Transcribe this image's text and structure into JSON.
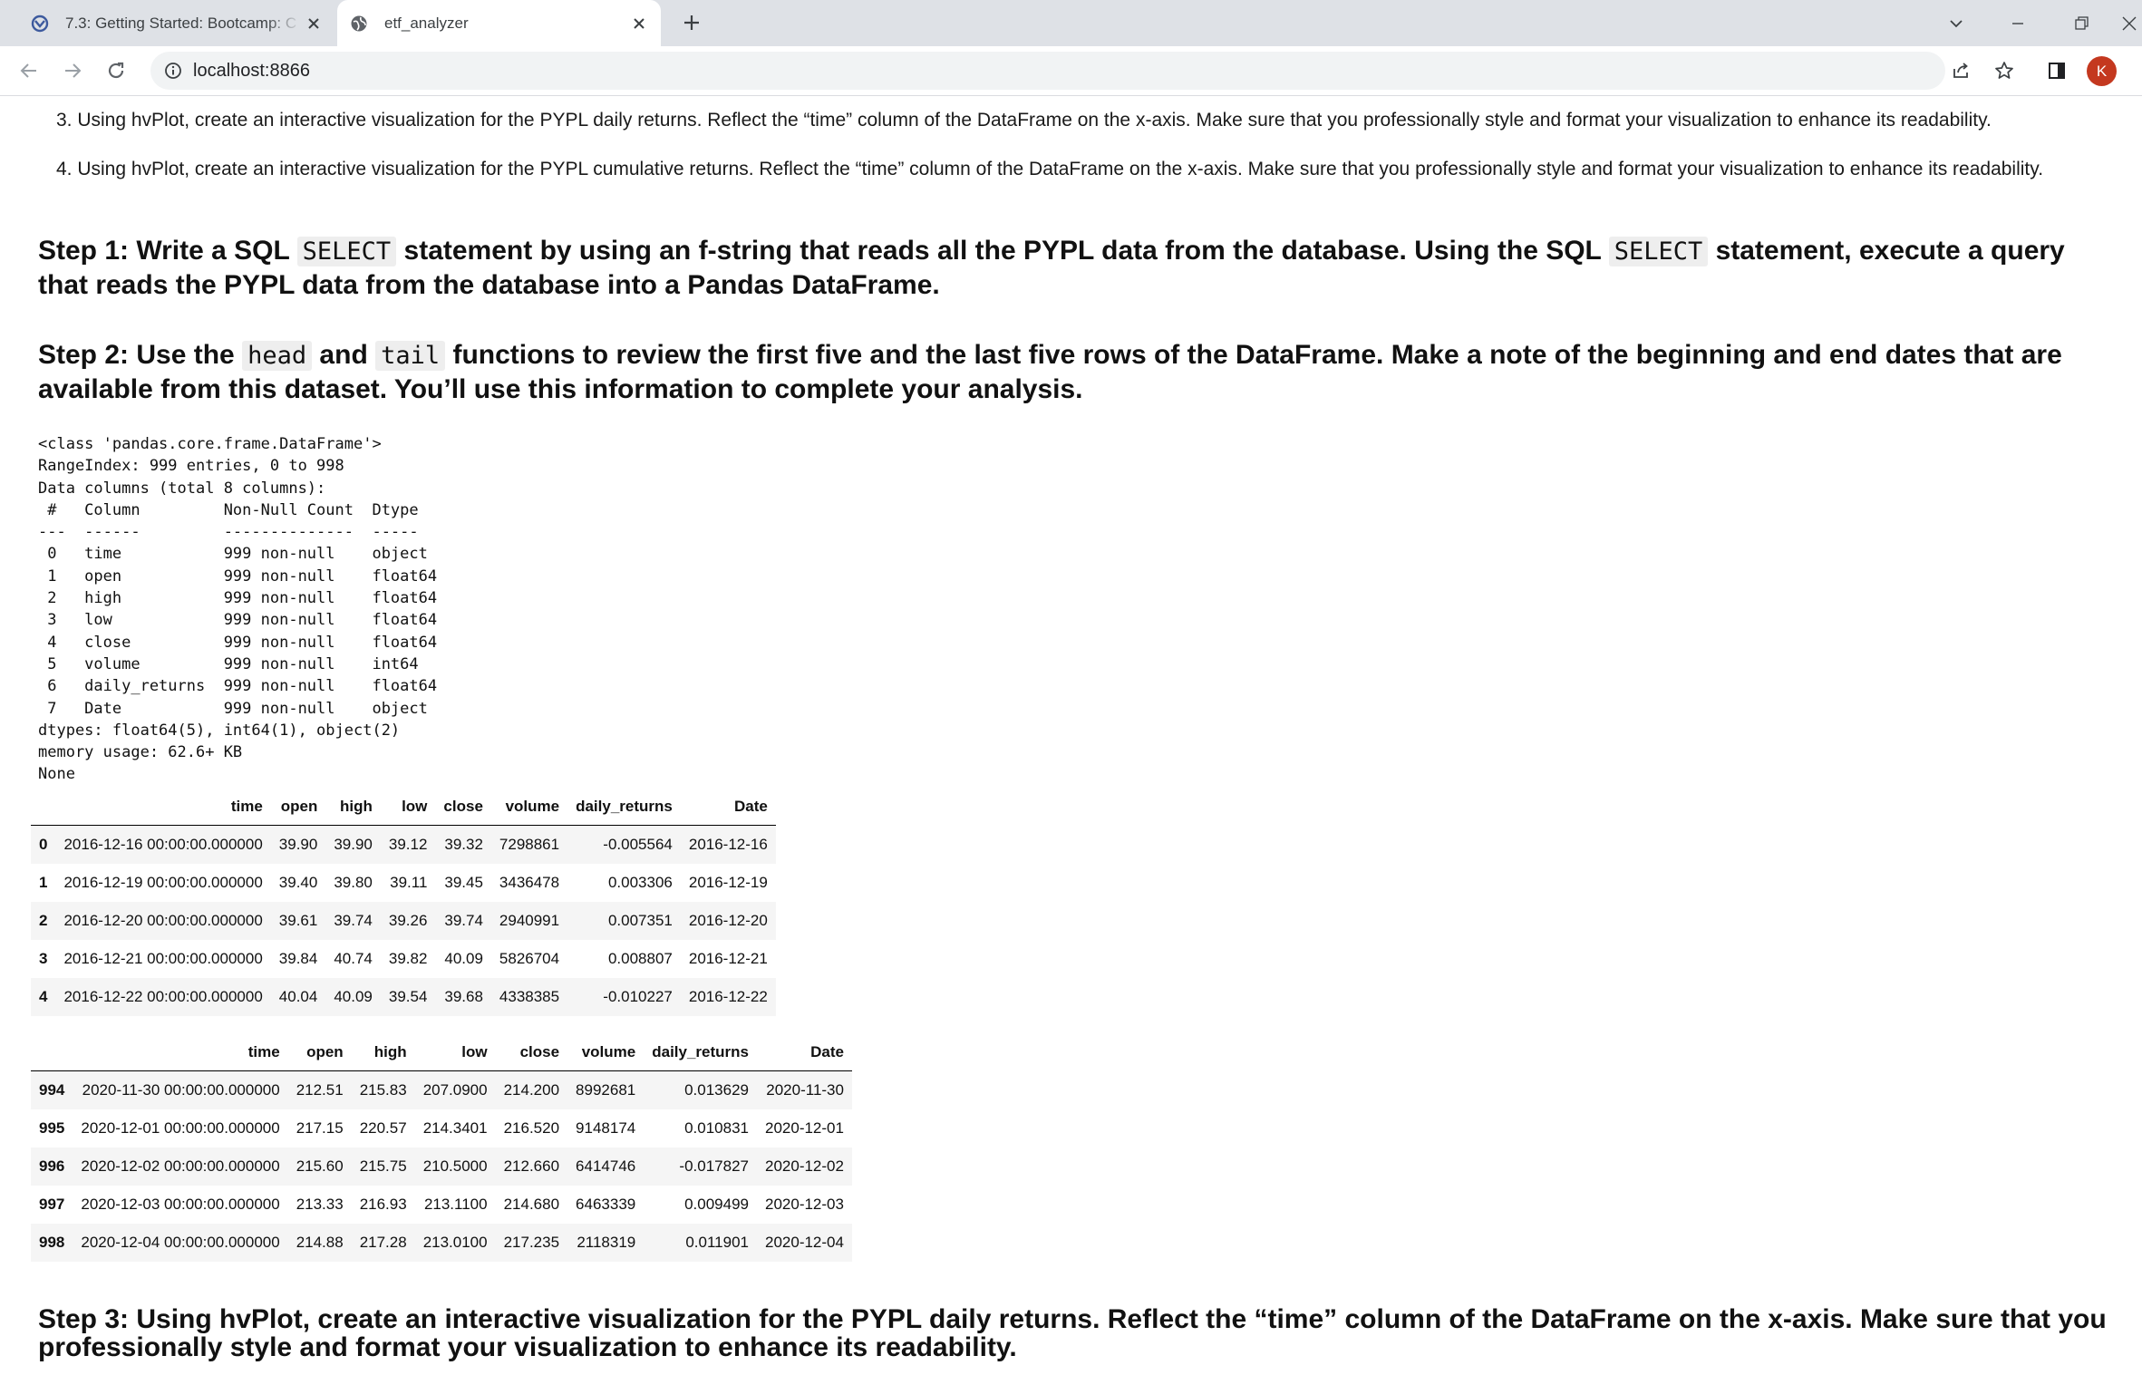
{
  "browser": {
    "tabs": [
      {
        "title": "7.3: Getting Started: Bootcamp: C",
        "icon": "bootcamp-logo-icon",
        "active": false
      },
      {
        "title": "etf_analyzer",
        "icon": "globe-icon",
        "active": true
      }
    ],
    "url": "localhost:8866",
    "avatar_initial": "K",
    "avatar_color": "#c4381f"
  },
  "notebook": {
    "list_items": [
      "3. Using hvPlot, create an interactive visualization for the PYPL daily returns. Reflect the “time” column of the DataFrame on the x-axis. Make sure that you professionally style and format your visualization to enhance its readability.",
      "4. Using hvPlot, create an interactive visualization for the PYPL cumulative returns. Reflect the “time” column of the DataFrame on the x-axis. Make sure that you professionally style and format your visualization to enhance its readability."
    ],
    "step1": {
      "part1": "Step 1: Write a SQL ",
      "code1": "SELECT",
      "part2": " statement by using an f-string that reads all the PYPL data from the database. Using the SQL ",
      "code2": "SELECT",
      "part3": " statement, execute a query that reads the PYPL data from the database into a Pandas DataFrame."
    },
    "step2": {
      "part1": "Step 2: Use the ",
      "code1": "head",
      "part2": " and ",
      "code2": "tail",
      "part3": " functions to review the first five and the last five rows of the DataFrame. Make a note of the beginning and end dates that are available from this dataset. You’ll use this information to complete your analysis."
    },
    "info_output": "<class 'pandas.core.frame.DataFrame'>\nRangeIndex: 999 entries, 0 to 998\nData columns (total 8 columns):\n #   Column         Non-Null Count  Dtype  \n---  ------         --------------  -----  \n 0   time           999 non-null    object \n 1   open           999 non-null    float64\n 2   high           999 non-null    float64\n 3   low            999 non-null    float64\n 4   close          999 non-null    float64\n 5   volume         999 non-null    int64  \n 6   daily_returns  999 non-null    float64\n 7   Date           999 non-null    object \ndtypes: float64(5), int64(1), object(2)\nmemory usage: 62.6+ KB\nNone",
    "head_table": {
      "columns": [
        "",
        "time",
        "open",
        "high",
        "low",
        "close",
        "volume",
        "daily_returns",
        "Date"
      ],
      "rows": [
        [
          "0",
          "2016-12-16 00:00:00.000000",
          "39.90",
          "39.90",
          "39.12",
          "39.32",
          "7298861",
          "-0.005564",
          "2016-12-16"
        ],
        [
          "1",
          "2016-12-19 00:00:00.000000",
          "39.40",
          "39.80",
          "39.11",
          "39.45",
          "3436478",
          "0.003306",
          "2016-12-19"
        ],
        [
          "2",
          "2016-12-20 00:00:00.000000",
          "39.61",
          "39.74",
          "39.26",
          "39.74",
          "2940991",
          "0.007351",
          "2016-12-20"
        ],
        [
          "3",
          "2016-12-21 00:00:00.000000",
          "39.84",
          "40.74",
          "39.82",
          "40.09",
          "5826704",
          "0.008807",
          "2016-12-21"
        ],
        [
          "4",
          "2016-12-22 00:00:00.000000",
          "40.04",
          "40.09",
          "39.54",
          "39.68",
          "4338385",
          "-0.010227",
          "2016-12-22"
        ]
      ]
    },
    "tail_table": {
      "columns": [
        "",
        "time",
        "open",
        "high",
        "low",
        "close",
        "volume",
        "daily_returns",
        "Date"
      ],
      "rows": [
        [
          "994",
          "2020-11-30 00:00:00.000000",
          "212.51",
          "215.83",
          "207.0900",
          "214.200",
          "8992681",
          "0.013629",
          "2020-11-30"
        ],
        [
          "995",
          "2020-12-01 00:00:00.000000",
          "217.15",
          "220.57",
          "214.3401",
          "216.520",
          "9148174",
          "0.010831",
          "2020-12-01"
        ],
        [
          "996",
          "2020-12-02 00:00:00.000000",
          "215.60",
          "215.75",
          "210.5000",
          "212.660",
          "6414746",
          "-0.017827",
          "2020-12-02"
        ],
        [
          "997",
          "2020-12-03 00:00:00.000000",
          "213.33",
          "216.93",
          "213.1100",
          "214.680",
          "6463339",
          "0.009499",
          "2020-12-03"
        ],
        [
          "998",
          "2020-12-04 00:00:00.000000",
          "214.88",
          "217.28",
          "213.0100",
          "217.235",
          "2118319",
          "0.011901",
          "2020-12-04"
        ]
      ]
    },
    "step3": "Step 3: Using hvPlot, create an interactive visualization for the PYPL daily returns. Reflect the “time” column of the DataFrame on the x-axis. Make sure that you professionally style and format your visualization to enhance its readability."
  }
}
